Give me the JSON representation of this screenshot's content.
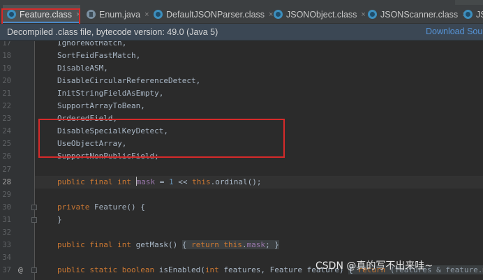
{
  "tabs": [
    {
      "label": "Feature.class",
      "active": true,
      "icon": "class-file-icon"
    },
    {
      "label": "Enum.java",
      "active": false,
      "icon": "java-file-icon"
    },
    {
      "label": "DefaultJSONParser.class",
      "active": false,
      "icon": "class-file-icon"
    },
    {
      "label": "JSONObject.class",
      "active": false,
      "icon": "class-file-icon"
    },
    {
      "label": "JSONScanner.class",
      "active": false,
      "icon": "class-file-icon"
    },
    {
      "label": "JS",
      "active": false,
      "icon": "class-file-icon"
    }
  ],
  "tab_close_glyph": "×",
  "banner": {
    "message": "Decompiled .class file, bytecode version: 49.0 (Java 5)",
    "download_link": "Download Sour"
  },
  "lines": [
    {
      "n": "17",
      "text": "IgnoreNotMatch,"
    },
    {
      "n": "18",
      "text": "SortFeidFastMatch,"
    },
    {
      "n": "19",
      "text": "DisableASM,"
    },
    {
      "n": "20",
      "text": "DisableCircularReferenceDetect,"
    },
    {
      "n": "21",
      "text": "InitStringFieldAsEmpty,"
    },
    {
      "n": "22",
      "text": "SupportArrayToBean,"
    },
    {
      "n": "23",
      "text": "OrderedField,"
    },
    {
      "n": "24",
      "text": "DisableSpecialKeyDetect,"
    },
    {
      "n": "25",
      "text": "UseObjectArray,"
    },
    {
      "n": "26",
      "text": "SupportNonPublicField;"
    },
    {
      "n": "27",
      "text": ""
    },
    {
      "n": "28",
      "kw1": "public final int ",
      "pre_caret": "",
      "ident": "mask",
      "op": " = ",
      "num": "1",
      "op2": " << ",
      "kw2": "this",
      "tail": ".ordinal();"
    },
    {
      "n": "29",
      "text": ""
    },
    {
      "n": "30",
      "kw": "private ",
      "rest": "Feature() {"
    },
    {
      "n": "31",
      "text": "}"
    },
    {
      "n": "32",
      "text": ""
    },
    {
      "n": "33",
      "kw": "public final int ",
      "rest": "getMask() ",
      "body_open": "{ ",
      "body_kw": "return ",
      "body_kw2": "this",
      "body_dot": ".",
      "body_fld": "mask",
      "body_close": "; }"
    },
    {
      "n": "34",
      "text": ""
    },
    {
      "n": "37",
      "kw": "public static boolean ",
      "rest": "isEnabled(",
      "kw_int": "int ",
      "rest2": "features, Feature feature) ",
      "body_open": "{ ",
      "body_kw": "return ",
      "rest3": "(features & feature.ma"
    }
  ],
  "gutter_annotation": "@",
  "watermark": "CSDN @真的写不出来哇~"
}
